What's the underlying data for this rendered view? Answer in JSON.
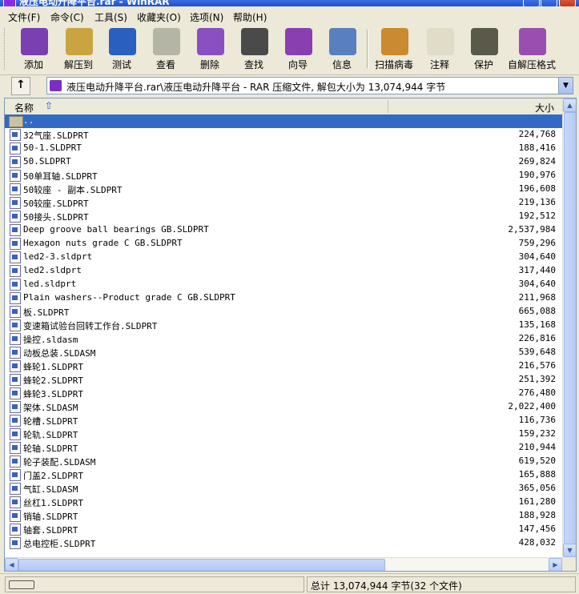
{
  "window": {
    "title": "液压电动升降平台.rar - WinRAR"
  },
  "menu": [
    "文件(F)",
    "命令(C)",
    "工具(S)",
    "收藏夹(O)",
    "选项(N)",
    "帮助(H)"
  ],
  "toolbar": [
    {
      "label": "添加",
      "icon": "add-icon",
      "color": "#7a3fb0"
    },
    {
      "label": "解压到",
      "icon": "extract-to-icon",
      "color": "#c9a441"
    },
    {
      "label": "测试",
      "icon": "test-icon",
      "color": "#2a5fc0"
    },
    {
      "label": "查看",
      "icon": "view-icon",
      "color": "#b5b5a5"
    },
    {
      "label": "删除",
      "icon": "delete-icon",
      "color": "#8a4fc0"
    },
    {
      "label": "查找",
      "icon": "find-icon",
      "color": "#4a4a4a"
    },
    {
      "label": "向导",
      "icon": "wizard-icon",
      "color": "#8a3fb0"
    },
    {
      "label": "信息",
      "icon": "info-icon",
      "color": "#5a7fbf"
    },
    {
      "label": "扫描病毒",
      "icon": "virus-scan-icon",
      "color": "#c98a30"
    },
    {
      "label": "注释",
      "icon": "comment-icon",
      "color": "#e0dcc8"
    },
    {
      "label": "保护",
      "icon": "protect-icon",
      "color": "#5a5a4a"
    },
    {
      "label": "自解压格式",
      "icon": "sfx-icon",
      "color": "#9a4fb0"
    }
  ],
  "address": {
    "text": "液压电动升降平台.rar\\液压电动升降平台 - RAR 压缩文件, 解包大小为 13,074,944 字节"
  },
  "columns": {
    "name": "名称",
    "size": "大小"
  },
  "files": [
    {
      "name": "..",
      "size": "",
      "folder": true
    },
    {
      "name": "32气座.SLDPRT",
      "size": "224,768"
    },
    {
      "name": "50-1.SLDPRT",
      "size": "188,416"
    },
    {
      "name": "50.SLDPRT",
      "size": "269,824"
    },
    {
      "name": "50单耳轴.SLDPRT",
      "size": "190,976"
    },
    {
      "name": "50较座 - 副本.SLDPRT",
      "size": "196,608"
    },
    {
      "name": "50较座.SLDPRT",
      "size": "219,136"
    },
    {
      "name": "50接头.SLDPRT",
      "size": "192,512"
    },
    {
      "name": "Deep groove ball bearings GB.SLDPRT",
      "size": "2,537,984"
    },
    {
      "name": "Hexagon nuts grade C GB.SLDPRT",
      "size": "759,296"
    },
    {
      "name": "led2-3.sldprt",
      "size": "304,640"
    },
    {
      "name": "led2.sldprt",
      "size": "317,440"
    },
    {
      "name": "led.sldprt",
      "size": "304,640"
    },
    {
      "name": "Plain washers--Product grade C GB.SLDPRT",
      "size": "211,968"
    },
    {
      "name": "板.SLDPRT",
      "size": "665,088"
    },
    {
      "name": "变速箱试验台回转工作台.SLDPRT",
      "size": "135,168"
    },
    {
      "name": "操控.sldasm",
      "size": "226,816"
    },
    {
      "name": "动板总装.SLDASM",
      "size": "539,648"
    },
    {
      "name": "蜂轮1.SLDPRT",
      "size": "216,576"
    },
    {
      "name": "蜂轮2.SLDPRT",
      "size": "251,392"
    },
    {
      "name": "蜂轮3.SLDPRT",
      "size": "276,480"
    },
    {
      "name": "架体.SLDASM",
      "size": "2,022,400"
    },
    {
      "name": "轮槽.SLDPRT",
      "size": "116,736"
    },
    {
      "name": "轮轨.SLDPRT",
      "size": "159,232"
    },
    {
      "name": "轮轴.SLDPRT",
      "size": "210,944"
    },
    {
      "name": "轮子装配.SLDASM",
      "size": "619,520"
    },
    {
      "name": "门盖2.SLDPRT",
      "size": "165,888"
    },
    {
      "name": "气缸.SLDASM",
      "size": "365,056"
    },
    {
      "name": "丝杠1.SLDPRT",
      "size": "161,280"
    },
    {
      "name": "销轴.SLDPRT",
      "size": "188,928"
    },
    {
      "name": "轴套.SLDPRT",
      "size": "147,456"
    },
    {
      "name": "总电控柜.SLDPRT",
      "size": "428,032"
    }
  ],
  "status": {
    "total": "总计 13,074,944 字节(32 个文件)"
  },
  "colors": {
    "selection": "#316ac5",
    "titlebar": "#1d4fd1",
    "chrome": "#ece9d8"
  }
}
